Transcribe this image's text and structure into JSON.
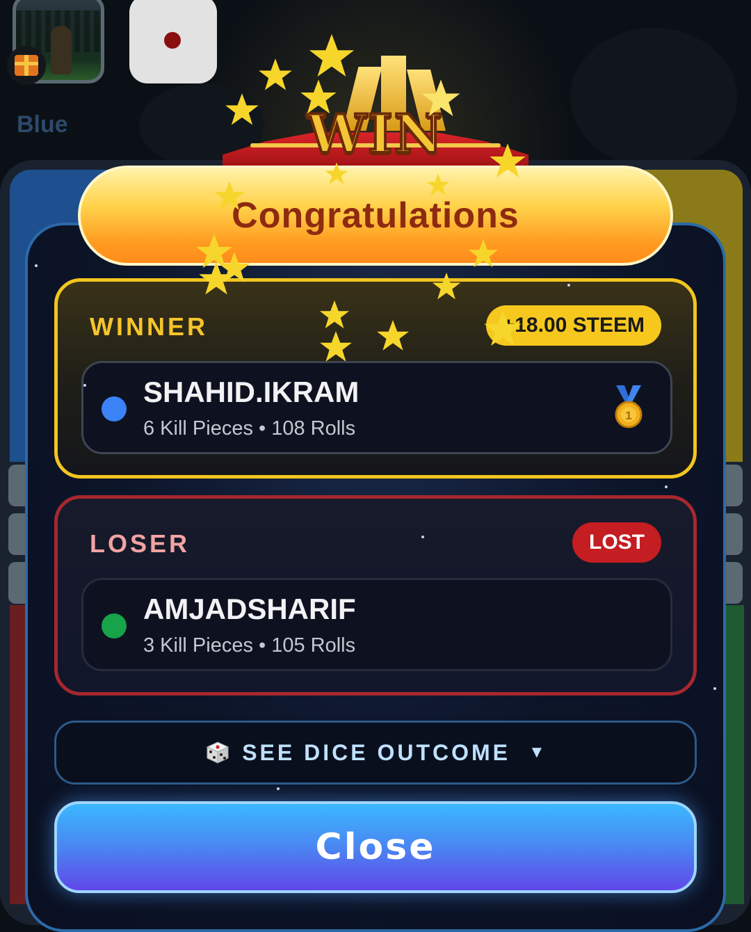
{
  "top_bar": {
    "player_color_label": "Blue"
  },
  "emblem": {
    "text": "WIN"
  },
  "banner": {
    "title": "Congratulations"
  },
  "winner": {
    "section_label": "WINNER",
    "amount_badge": "+18.00 STEEM",
    "player_name": "SHAHID.IKRAM",
    "stats": "6 Kill Pieces • 108 Rolls",
    "dot_color": "#3b82f6",
    "icon": "gold-medal-icon"
  },
  "loser": {
    "section_label": "LOSER",
    "status_badge": "LOST",
    "player_name": "AMJADSHARIF",
    "stats": "3 Kill Pieces • 105 Rolls",
    "dot_color": "#16a34a"
  },
  "dice_outcome": {
    "label": "SEE DICE OUTCOME",
    "caret": "▼",
    "icon": "dice-icon"
  },
  "close_button": {
    "label": "Close"
  },
  "colors": {
    "winner_border": "#f3c51e",
    "loser_border": "#a5282f",
    "amount_badge_bg": "#f6c81e",
    "lost_badge_bg": "#c41d22",
    "close_gradient_top": "#3bb8ff",
    "close_gradient_bottom": "#6048e8"
  }
}
